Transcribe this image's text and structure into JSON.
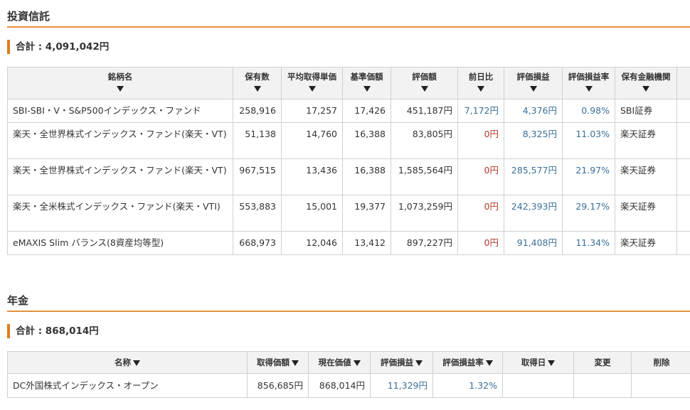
{
  "investment": {
    "title": "投資信託",
    "total": "合計 : 4,091,042円",
    "columns": [
      "銘柄名",
      "保有数",
      "平均取得単価",
      "基準価額",
      "評価額",
      "前日比",
      "評価損益",
      "評価損益率",
      "保有金融機関"
    ],
    "rows": [
      {
        "name": "SBI-SBI・V・S&P500インデックス・ファンド",
        "qty": "258,916",
        "avg": "17,257",
        "base": "17,426",
        "value": "451,187円",
        "dod": "7,172円",
        "pl": "4,376円",
        "plr": "0.98%",
        "inst": "SBI証券"
      },
      {
        "name": "楽天・全世界株式インデックス・ファンド(楽天・VT)",
        "qty": "51,138",
        "avg": "14,760",
        "base": "16,388",
        "value": "83,805円",
        "dod": "0円",
        "pl": "8,325円",
        "plr": "11.03%",
        "inst": "楽天証券"
      },
      {
        "name": "楽天・全世界株式インデックス・ファンド(楽天・VT)",
        "qty": "967,515",
        "avg": "13,436",
        "base": "16,388",
        "value": "1,585,564円",
        "dod": "0円",
        "pl": "285,577円",
        "plr": "21.97%",
        "inst": "楽天証券"
      },
      {
        "name": "楽天・全米株式インデックス・ファンド(楽天・VTI)",
        "qty": "553,883",
        "avg": "15,001",
        "base": "19,377",
        "value": "1,073,259円",
        "dod": "0円",
        "pl": "242,393円",
        "plr": "29.17%",
        "inst": "楽天証券"
      },
      {
        "name": "eMAXIS Slim バランス(8資産均等型)",
        "qty": "668,973",
        "avg": "12,046",
        "base": "13,412",
        "value": "897,227円",
        "dod": "0円",
        "pl": "91,408円",
        "plr": "11.34%",
        "inst": "楽天証券"
      }
    ]
  },
  "pension": {
    "title": "年金",
    "total": "合計 : 868,014円",
    "columns": [
      "名称",
      "取得価額",
      "現在価値",
      "評価損益",
      "評価損益率",
      "取得日",
      "変更",
      "削除"
    ],
    "rows": [
      {
        "name": "DC外国株式インデックス・オープン",
        "cost": "856,685円",
        "current": "868,014円",
        "pl": "11,329円",
        "plr": "1.32%",
        "date": "",
        "edit": "",
        "del": ""
      }
    ]
  },
  "colors": {
    "accent_rule": "#e3903c",
    "total_bar": "#e07c1c",
    "positive": "#3a6f98",
    "zero": "#b03a2e",
    "header_bg": "#f2f2f2"
  }
}
